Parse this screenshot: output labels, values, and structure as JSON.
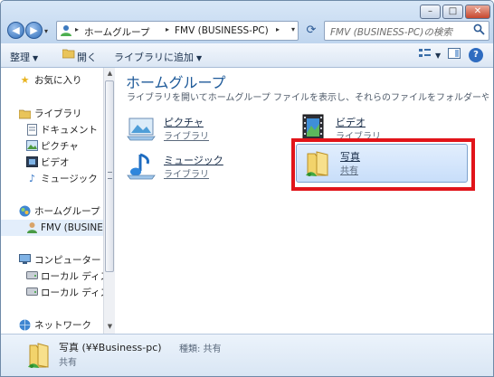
{
  "window": {
    "controls": {
      "minimize": "–",
      "maximize": "□",
      "close": "✕"
    }
  },
  "nav": {
    "back_icon": "◀",
    "forward_icon": "▶",
    "dropdown_icon": "▾"
  },
  "address": {
    "icon": "homegroup-icon",
    "crumbs": [
      "ホームグループ",
      "FMV (BUSINESS-PC)"
    ],
    "arrow": "▸",
    "dropdown": "▾"
  },
  "search": {
    "placeholder": "FMV (BUSINESS-PC)の検索",
    "icon": "search-icon"
  },
  "toolbar": {
    "organize_label": "整理",
    "open_label": "開く",
    "add_library_label": "ライブラリに追加",
    "caret": "▼",
    "help_label": "?"
  },
  "sidebar": {
    "items": [
      {
        "label": "お気に入り",
        "icon": "star-icon"
      },
      {
        "label": "ライブラリ",
        "icon": "library-icon"
      },
      {
        "label": "ドキュメント",
        "icon": "document-icon"
      },
      {
        "label": "ピクチャ",
        "icon": "picture-icon"
      },
      {
        "label": "ビデオ",
        "icon": "video-icon"
      },
      {
        "label": "ミュージック",
        "icon": "music-icon"
      },
      {
        "label": "ホームグループ",
        "icon": "homegroup-icon"
      },
      {
        "label": "FMV (BUSINES",
        "icon": "user-icon"
      },
      {
        "label": "コンピューター",
        "icon": "computer-icon"
      },
      {
        "label": "ローカル ディス",
        "icon": "disk-icon"
      },
      {
        "label": "ローカル ディス",
        "icon": "disk-icon"
      },
      {
        "label": "ネットワーク",
        "icon": "network-icon"
      }
    ]
  },
  "main": {
    "title": "ホームグループ",
    "description": "ライブラリを開いてホームグループ ファイルを表示し、それらのファイルをフォルダーや...",
    "tiles": [
      {
        "name": "ピクチャ",
        "sub": "ライブラリ",
        "icon": "pictures-library-icon"
      },
      {
        "name": "ビデオ",
        "sub": "ライブラリ",
        "icon": "videos-library-icon"
      },
      {
        "name": "ミュージック",
        "sub": "ライブラリ",
        "icon": "music-library-icon"
      },
      {
        "name": "写真",
        "sub": "共有",
        "icon": "shared-folder-icon"
      }
    ]
  },
  "status": {
    "name": "写真 (¥¥Business-pc)",
    "type": "種類: 共有",
    "sub": "共有"
  },
  "colors": {
    "accent": "#1e5a99",
    "highlight": "#e1141a"
  }
}
